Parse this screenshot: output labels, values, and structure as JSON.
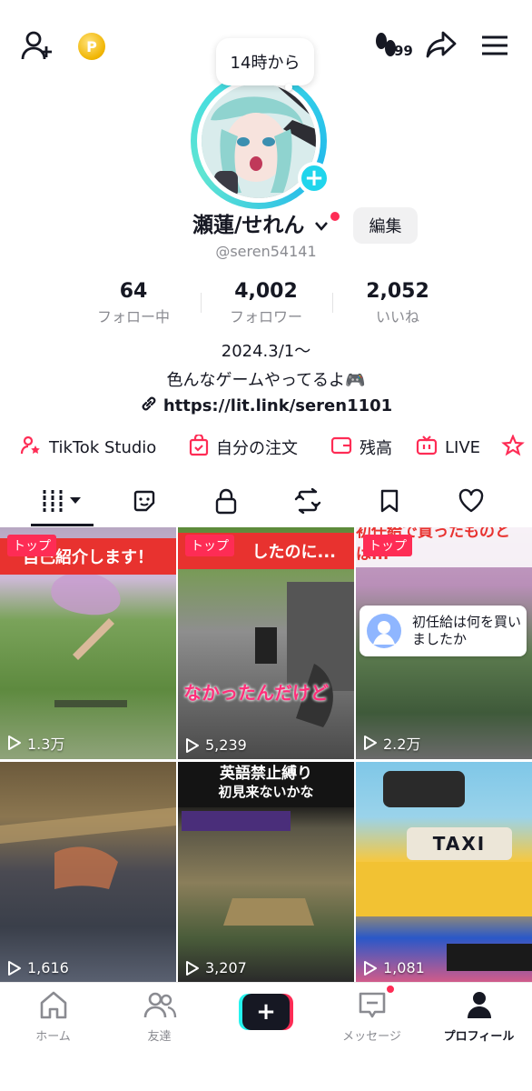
{
  "top_bar": {
    "add_friend_icon": "person-plus-icon",
    "coin_icon": "coin-icon",
    "coin_symbol": "P",
    "visitor_icon": "footprints-icon",
    "visitor_count": "99",
    "share_icon": "share-arrow-icon",
    "menu_icon": "hamburger-menu-icon"
  },
  "profile": {
    "status_bubble": "14時から",
    "display_name": "瀬蓮/せれん",
    "edit_label": "編集",
    "handle": "@seren54141"
  },
  "stats": [
    {
      "value": "64",
      "label": "フォロー中"
    },
    {
      "value": "4,002",
      "label": "フォロワー"
    },
    {
      "value": "2,052",
      "label": "いいね"
    }
  ],
  "bio": {
    "line1": "2024.3/1〜",
    "line2": "色んなゲームやってるよ🎮",
    "link": "https://lit.link/seren1101"
  },
  "shortcuts": [
    {
      "label": "TikTok Studio",
      "icon": "person-star-icon"
    },
    {
      "label": "自分の注文",
      "icon": "order-bag-icon"
    },
    {
      "label": "残高",
      "icon": "wallet-icon"
    },
    {
      "label": "LIVE",
      "icon": "tv-icon"
    }
  ],
  "content_tabs": [
    "videos-grid-icon",
    "sticker-icon",
    "lock-icon",
    "repost-icon",
    "bookmark-icon",
    "heart-icon"
  ],
  "videos": [
    {
      "pinned": "トップ",
      "caption": "自己紹介します！",
      "views": "1.3万"
    },
    {
      "pinned": "トップ",
      "caption": "したのに...",
      "overlay": "なかったんだけど",
      "views": "5,239"
    },
    {
      "pinned": "トップ",
      "caption": "初任給で買ったものとは...",
      "notification": "初任給は何を買いましたか",
      "views": "2.2万"
    },
    {
      "views": "1,616"
    },
    {
      "caption": "英語禁止縛り",
      "subcaption": "初見来ないかな",
      "views": "3,207"
    },
    {
      "sign": "TAXI",
      "views": "1,081"
    }
  ],
  "bottom_nav": [
    {
      "label": "ホーム",
      "icon": "home-icon"
    },
    {
      "label": "友達",
      "icon": "friends-icon"
    },
    {
      "label": "+",
      "icon": "create-plus-icon"
    },
    {
      "label": "メッセージ",
      "icon": "inbox-icon"
    },
    {
      "label": "プロフィール",
      "icon": "profile-icon"
    }
  ],
  "colors": {
    "accent_red": "#fe2c55",
    "accent_cyan": "#25f4ee",
    "text_primary": "#161823",
    "text_secondary": "#8a8b91"
  }
}
